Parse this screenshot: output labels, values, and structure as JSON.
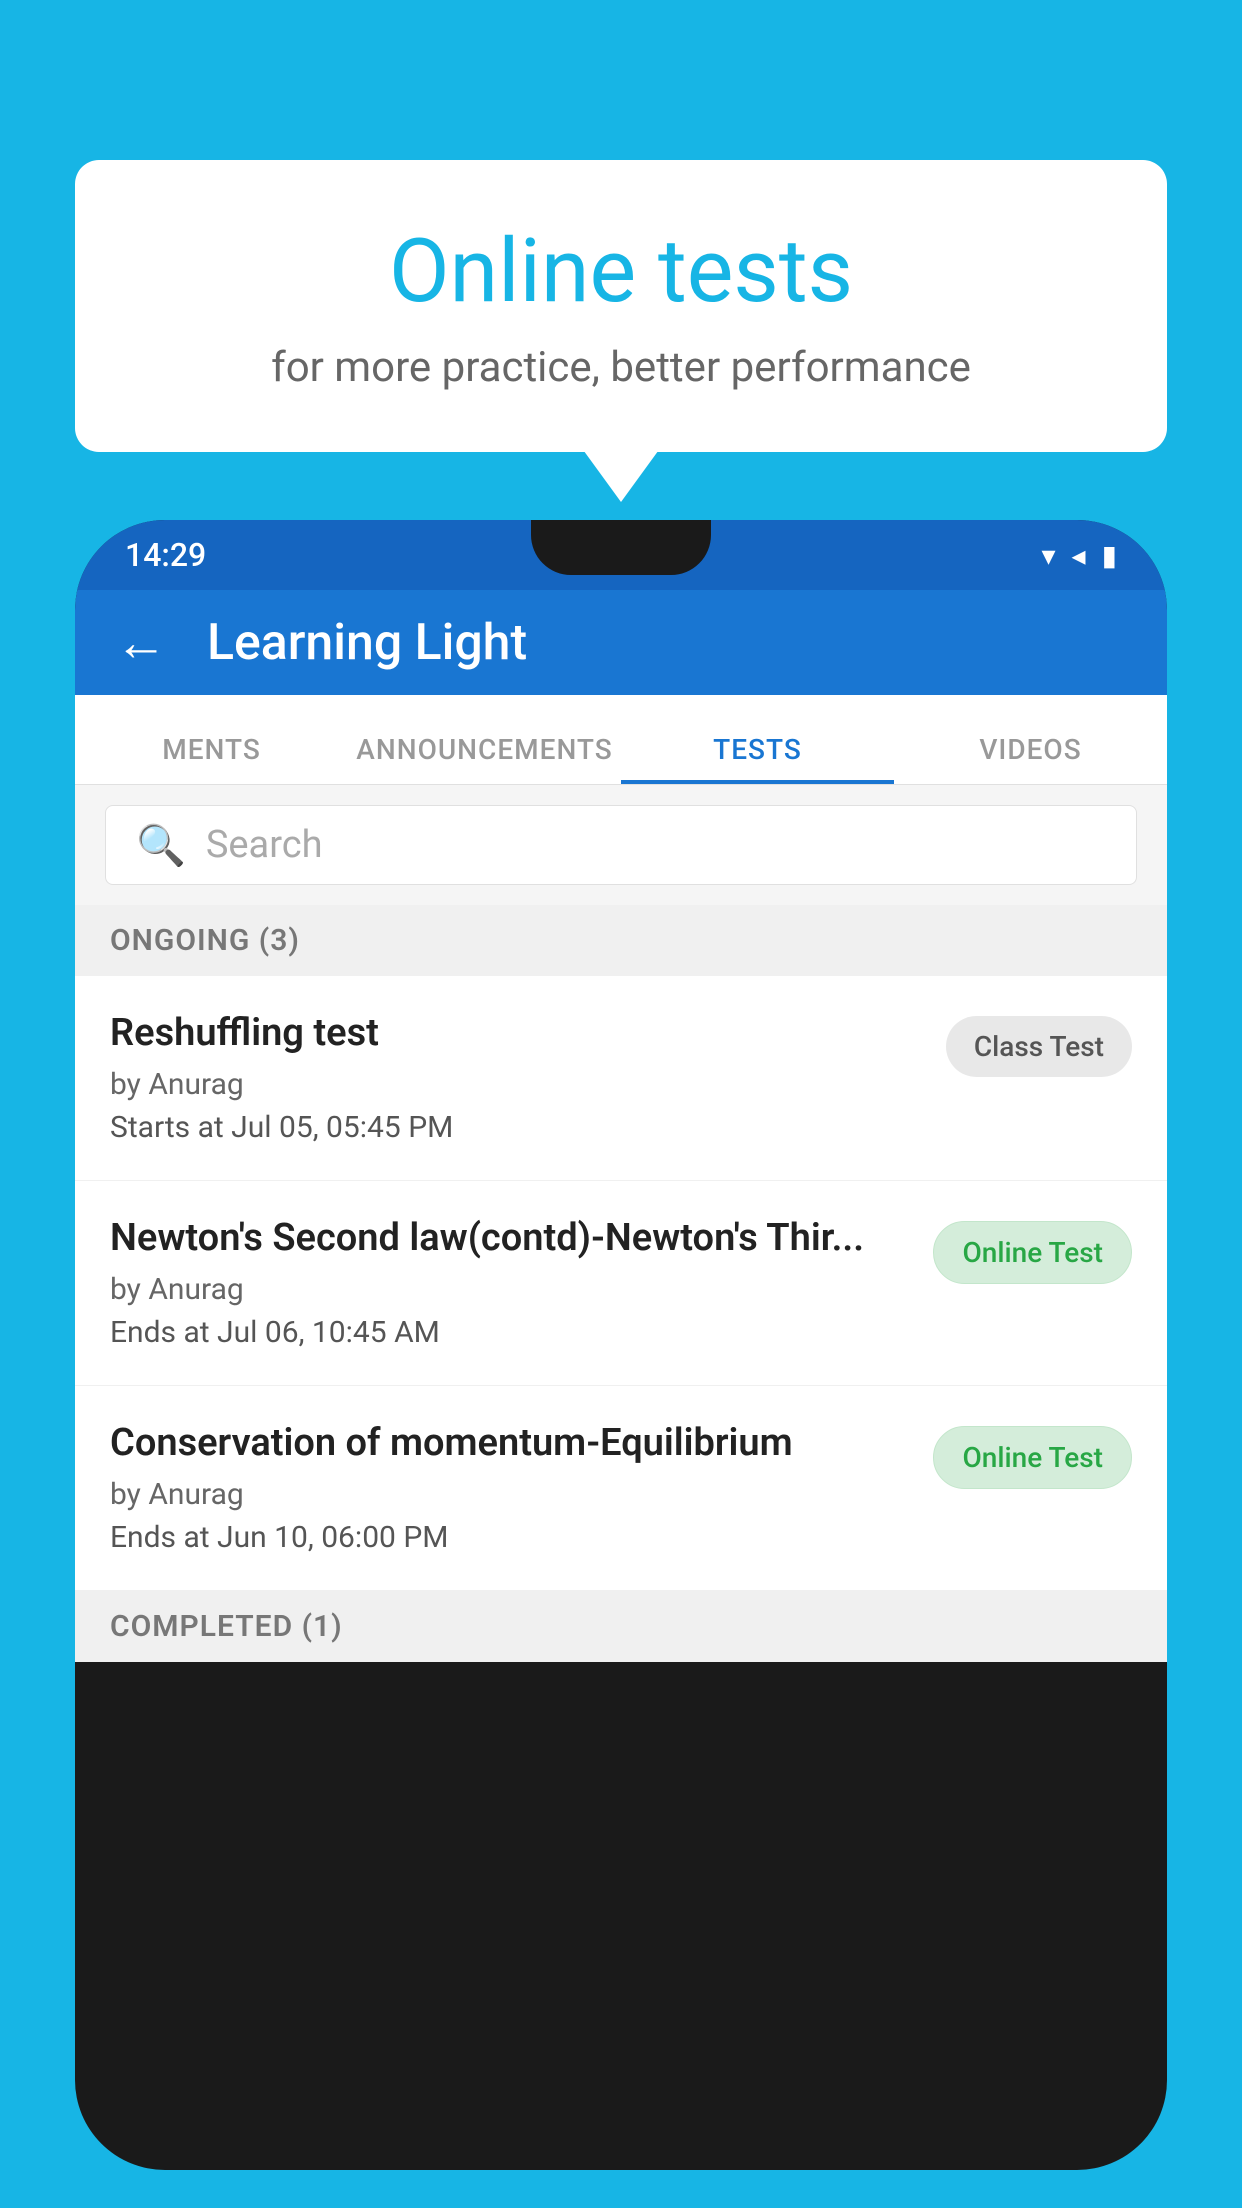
{
  "background_color": "#17B5E5",
  "bubble": {
    "title": "Online tests",
    "subtitle": "for more practice, better performance"
  },
  "status_bar": {
    "time": "14:29",
    "wifi_icon": "▼",
    "signal_icon": "◀",
    "battery_icon": "▮"
  },
  "app_bar": {
    "back_icon": "←",
    "title": "Learning Light"
  },
  "tabs": [
    {
      "label": "MENTS",
      "active": false
    },
    {
      "label": "ANNOUNCEMENTS",
      "active": false
    },
    {
      "label": "TESTS",
      "active": true
    },
    {
      "label": "VIDEOS",
      "active": false
    }
  ],
  "search": {
    "placeholder": "Search",
    "icon": "🔍"
  },
  "ongoing_section": {
    "label": "ONGOING (3)"
  },
  "tests": [
    {
      "name": "Reshuffling test",
      "author": "by Anurag",
      "date": "Starts at  Jul 05, 05:45 PM",
      "badge": "Class Test",
      "badge_type": "class"
    },
    {
      "name": "Newton's Second law(contd)-Newton's Thir...",
      "author": "by Anurag",
      "date": "Ends at  Jul 06, 10:45 AM",
      "badge": "Online Test",
      "badge_type": "online"
    },
    {
      "name": "Conservation of momentum-Equilibrium",
      "author": "by Anurag",
      "date": "Ends at  Jun 10, 06:00 PM",
      "badge": "Online Test",
      "badge_type": "online"
    }
  ],
  "completed_section": {
    "label": "COMPLETED (1)"
  }
}
